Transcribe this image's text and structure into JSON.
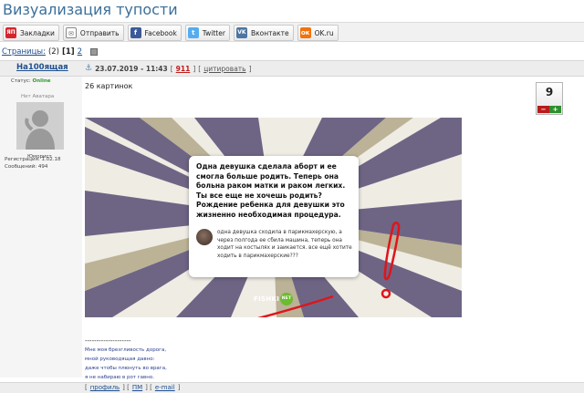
{
  "title": "Визуализация тупости",
  "share": {
    "yandex": {
      "icon": "yandex-icon",
      "icon_text": "ЯП",
      "label": "Закладки"
    },
    "mail": {
      "icon": "envelope-icon",
      "icon_text": "✉",
      "label": "Отправить"
    },
    "facebook": {
      "icon": "facebook-icon",
      "icon_text": "f",
      "label": "Facebook"
    },
    "twitter": {
      "icon": "twitter-icon",
      "icon_text": "t",
      "label": "Twitter"
    },
    "vkontakte": {
      "icon": "vk-icon",
      "icon_text": "VK",
      "label": "Вконтакте"
    },
    "ok": {
      "icon": "ok-icon",
      "icon_text": "ок",
      "label": "OK.ru"
    }
  },
  "pagination": {
    "label": "Страницы:",
    "count": "(2)",
    "current": "[1]",
    "next": "2"
  },
  "post": {
    "author": "На100ящая",
    "date": "23.07.2019 - 11:43",
    "number_open": "[",
    "number": "911",
    "number_close": "]",
    "quote_open": "[",
    "quote": "цитировать",
    "quote_close": "]",
    "text": "26 картинок",
    "rating": {
      "value": "9",
      "minus": "−",
      "plus": "+"
    }
  },
  "user": {
    "status_label": "Статус:",
    "status_value": "Online",
    "no_avatar": "Нет Аватара",
    "rank": "Юморист",
    "registration": "Регистрация: 1.02.18",
    "messages": "Сообщений: 494"
  },
  "meme": {
    "question": "Одна девушка сделала аборт и ее смогла больше родить. Теперь она больна раком матки и раком легких. Ты все еще не хочешь родить? Рождение ребенка для девушки это жизненно необходимая процедура.",
    "answer": "одна девушка сходила в парикмахерскую, а через полгода ее сбила машина, теперь она ходит на костылях и заикается. все ещё хотите ходить в парикмахерские???",
    "watermark_text": "FISHKI",
    "watermark_dot": "NET"
  },
  "signature": {
    "divider": "--------------------",
    "line1": "Мне моя брезгливость дорога,",
    "line2": "мной руководящая давно:",
    "line3": "даже чтобы плюнуть во врага,",
    "line4": "я не набираю в рот гавно."
  },
  "footer": {
    "open1": "[",
    "profile": "профиль",
    "sep1": "] [",
    "pm": "ПМ",
    "sep2": "] [",
    "email": "e-mail",
    "close": "]"
  },
  "colors": {
    "title": "#3a6f9a",
    "link": "#1e4f8f",
    "post_number": "#c21b1b",
    "online": "#2c9a2c",
    "rating_minus": "#b81c1c",
    "rating_plus": "#2f8f2f",
    "scribble": "#e0141b"
  }
}
